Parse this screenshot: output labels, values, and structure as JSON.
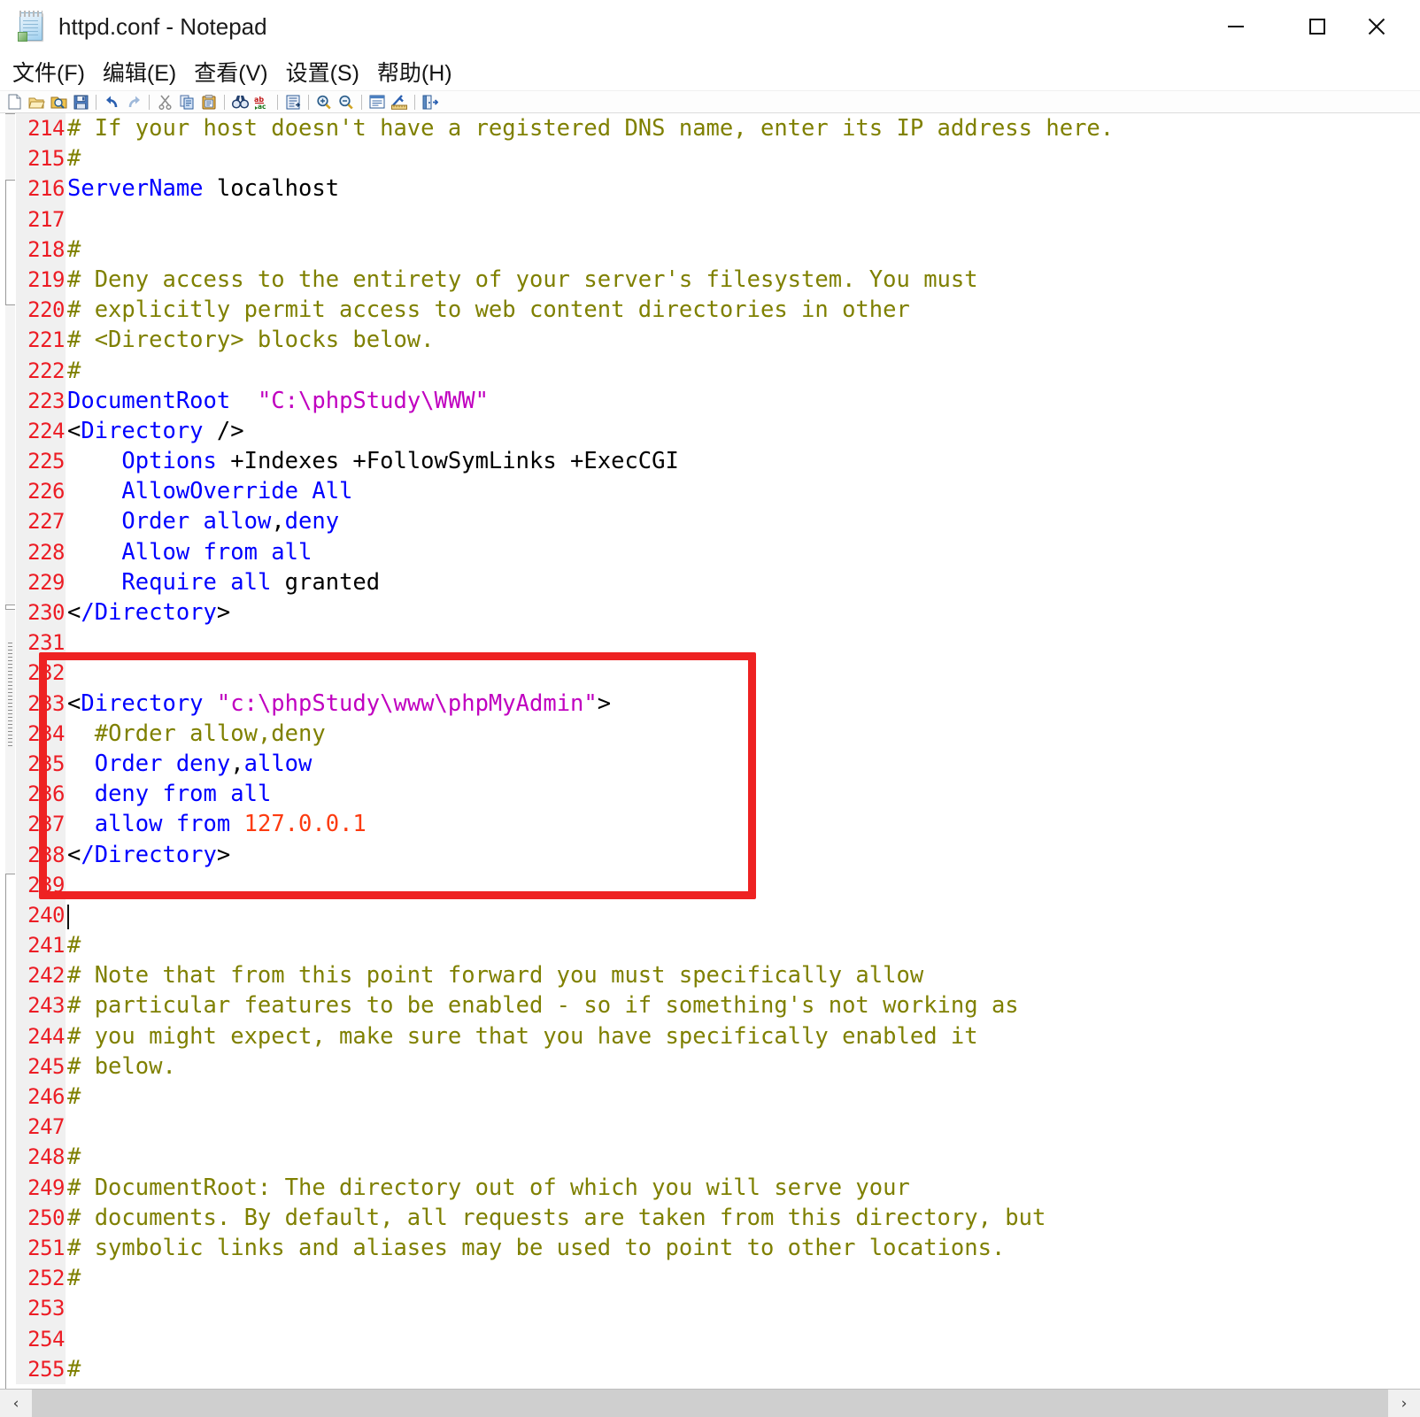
{
  "window": {
    "title": "httpd.conf - Notepad",
    "icon": "notepad-icon",
    "minimize_label": "–",
    "maximize_label": "□",
    "close_label": "✕"
  },
  "menubar": {
    "items": [
      {
        "label": "文件(F)",
        "name": "menu-file"
      },
      {
        "label": "编辑(E)",
        "name": "menu-edit"
      },
      {
        "label": "查看(V)",
        "name": "menu-view"
      },
      {
        "label": "设置(S)",
        "name": "menu-settings"
      },
      {
        "label": "帮助(H)",
        "name": "menu-help"
      }
    ]
  },
  "toolbar": {
    "buttons": [
      {
        "icon": "new-file-icon",
        "title": "New"
      },
      {
        "icon": "open-folder-icon",
        "title": "Open"
      },
      {
        "icon": "print-preview-icon",
        "title": "Print Preview"
      },
      {
        "icon": "save-floppy-icon",
        "title": "Save"
      },
      {
        "icon": "undo-arrow-icon",
        "title": "Undo"
      },
      {
        "icon": "redo-arrow-icon",
        "title": "Redo"
      },
      {
        "icon": "cut-scissors-icon",
        "title": "Cut"
      },
      {
        "icon": "copy-icon",
        "title": "Copy"
      },
      {
        "icon": "paste-clipboard-icon",
        "title": "Paste"
      },
      {
        "icon": "find-binoculars-icon",
        "title": "Find"
      },
      {
        "icon": "replace-abc-icon",
        "title": "Replace"
      },
      {
        "icon": "goto-line-icon",
        "title": "Go To"
      },
      {
        "icon": "zoom-in-icon",
        "title": "Zoom In"
      },
      {
        "icon": "zoom-out-icon",
        "title": "Zoom Out"
      },
      {
        "icon": "properties-icon",
        "title": "Properties"
      },
      {
        "icon": "edit-ruler-icon",
        "title": "Edit"
      },
      {
        "icon": "exit-door-icon",
        "title": "Exit"
      }
    ]
  },
  "editor": {
    "first_visible_line": 214,
    "last_visible_line": 254,
    "caret_line": 240,
    "colors": {
      "line_number": "#ec1c24",
      "gutter_background": "#f0f0f0",
      "comment": "#7f8000",
      "directive": "#0000ff",
      "string": "#c000c0",
      "number": "#fc3b10",
      "plain": "#000000",
      "annotation_box": "#ee2222"
    },
    "lines": [
      {
        "n": 214,
        "tokens": [
          {
            "t": "# If your host doesn't have a registered DNS name, enter its IP address here.",
            "c": "cm"
          }
        ]
      },
      {
        "n": 215,
        "tokens": [
          {
            "t": "#",
            "c": "cm"
          }
        ]
      },
      {
        "n": 216,
        "tokens": [
          {
            "t": "ServerName",
            "c": "kw"
          },
          {
            "t": " localhost",
            "c": "pl"
          }
        ]
      },
      {
        "n": 217,
        "tokens": [
          {
            "t": "",
            "c": "pl"
          }
        ]
      },
      {
        "n": 218,
        "tokens": [
          {
            "t": "#",
            "c": "cm"
          }
        ]
      },
      {
        "n": 219,
        "tokens": [
          {
            "t": "# Deny access to the entirety of your server's filesystem. You must",
            "c": "cm"
          }
        ]
      },
      {
        "n": 220,
        "tokens": [
          {
            "t": "# explicitly permit access to web content directories in other",
            "c": "cm"
          }
        ]
      },
      {
        "n": 221,
        "tokens": [
          {
            "t": "# <Directory> blocks below.",
            "c": "cm"
          }
        ]
      },
      {
        "n": 222,
        "tokens": [
          {
            "t": "#",
            "c": "cm"
          }
        ]
      },
      {
        "n": 223,
        "tokens": [
          {
            "t": "DocumentRoot",
            "c": "kw"
          },
          {
            "t": "  ",
            "c": "pl"
          },
          {
            "t": "\"C:\\phpStudy\\WWW\"",
            "c": "str"
          }
        ]
      },
      {
        "n": 224,
        "tokens": [
          {
            "t": "<",
            "c": "pl"
          },
          {
            "t": "Directory",
            "c": "kw"
          },
          {
            "t": " />",
            "c": "pl"
          }
        ]
      },
      {
        "n": 225,
        "tokens": [
          {
            "t": "    ",
            "c": "pl"
          },
          {
            "t": "Options",
            "c": "kw"
          },
          {
            "t": " +Indexes +FollowSymLinks +ExecCGI",
            "c": "pl"
          }
        ]
      },
      {
        "n": 226,
        "tokens": [
          {
            "t": "    ",
            "c": "pl"
          },
          {
            "t": "AllowOverride All",
            "c": "kw"
          }
        ]
      },
      {
        "n": 227,
        "tokens": [
          {
            "t": "    ",
            "c": "pl"
          },
          {
            "t": "Order allow",
            "c": "kw"
          },
          {
            "t": ",",
            "c": "pl"
          },
          {
            "t": "deny",
            "c": "kw"
          }
        ]
      },
      {
        "n": 228,
        "tokens": [
          {
            "t": "    ",
            "c": "pl"
          },
          {
            "t": "Allow from all",
            "c": "kw"
          }
        ]
      },
      {
        "n": 229,
        "tokens": [
          {
            "t": "    ",
            "c": "pl"
          },
          {
            "t": "Require all",
            "c": "kw"
          },
          {
            "t": " granted",
            "c": "pl"
          }
        ]
      },
      {
        "n": 230,
        "tokens": [
          {
            "t": "<",
            "c": "pl"
          },
          {
            "t": "/Directory",
            "c": "kw"
          },
          {
            "t": ">",
            "c": "pl"
          }
        ]
      },
      {
        "n": 231,
        "tokens": [
          {
            "t": "",
            "c": "pl"
          }
        ]
      },
      {
        "n": 232,
        "tokens": [
          {
            "t": "",
            "c": "pl"
          }
        ]
      },
      {
        "n": 233,
        "tokens": [
          {
            "t": "<",
            "c": "pl"
          },
          {
            "t": "Directory",
            "c": "kw"
          },
          {
            "t": " ",
            "c": "pl"
          },
          {
            "t": "\"c:\\phpStudy\\www\\phpMyAdmin\"",
            "c": "str"
          },
          {
            "t": ">",
            "c": "pl"
          }
        ]
      },
      {
        "n": 234,
        "tokens": [
          {
            "t": "  ",
            "c": "pl"
          },
          {
            "t": "#Order allow,deny",
            "c": "cm"
          }
        ]
      },
      {
        "n": 235,
        "tokens": [
          {
            "t": "  ",
            "c": "pl"
          },
          {
            "t": "Order deny",
            "c": "kw"
          },
          {
            "t": ",",
            "c": "pl"
          },
          {
            "t": "allow",
            "c": "kw"
          }
        ]
      },
      {
        "n": 236,
        "tokens": [
          {
            "t": "  ",
            "c": "pl"
          },
          {
            "t": "deny from all",
            "c": "kw"
          }
        ]
      },
      {
        "n": 237,
        "tokens": [
          {
            "t": "  ",
            "c": "pl"
          },
          {
            "t": "allow from ",
            "c": "kw"
          },
          {
            "t": "127.0.0.1",
            "c": "num"
          }
        ]
      },
      {
        "n": 238,
        "tokens": [
          {
            "t": "<",
            "c": "pl"
          },
          {
            "t": "/Directory",
            "c": "kw"
          },
          {
            "t": ">",
            "c": "pl"
          }
        ]
      },
      {
        "n": 239,
        "tokens": [
          {
            "t": "",
            "c": "pl"
          }
        ]
      },
      {
        "n": 240,
        "tokens": [
          {
            "t": "",
            "c": "pl"
          }
        ],
        "caret": true
      },
      {
        "n": 241,
        "tokens": [
          {
            "t": "#",
            "c": "cm"
          }
        ]
      },
      {
        "n": 242,
        "tokens": [
          {
            "t": "# Note that from this point forward you must specifically allow",
            "c": "cm"
          }
        ]
      },
      {
        "n": 243,
        "tokens": [
          {
            "t": "# particular features to be enabled - so if something's not working as",
            "c": "cm"
          }
        ]
      },
      {
        "n": 244,
        "tokens": [
          {
            "t": "# you might expect, make sure that you have specifically enabled it",
            "c": "cm"
          }
        ]
      },
      {
        "n": 245,
        "tokens": [
          {
            "t": "# below.",
            "c": "cm"
          }
        ]
      },
      {
        "n": 246,
        "tokens": [
          {
            "t": "#",
            "c": "cm"
          }
        ]
      },
      {
        "n": 247,
        "tokens": [
          {
            "t": "",
            "c": "pl"
          }
        ]
      },
      {
        "n": 248,
        "tokens": [
          {
            "t": "#",
            "c": "cm"
          }
        ]
      },
      {
        "n": 249,
        "tokens": [
          {
            "t": "# DocumentRoot: The directory out of which you will serve your",
            "c": "cm"
          }
        ]
      },
      {
        "n": 250,
        "tokens": [
          {
            "t": "# documents. By default, all requests are taken from this directory, but",
            "c": "cm"
          }
        ]
      },
      {
        "n": 251,
        "tokens": [
          {
            "t": "# symbolic links and aliases may be used to point to other locations.",
            "c": "cm"
          }
        ]
      },
      {
        "n": 252,
        "tokens": [
          {
            "t": "#",
            "c": "cm"
          }
        ]
      },
      {
        "n": 253,
        "tokens": [
          {
            "t": "",
            "c": "pl"
          }
        ]
      },
      {
        "n": 254,
        "tokens": [
          {
            "t": "",
            "c": "pl"
          }
        ]
      },
      {
        "n": 255,
        "tokens": [
          {
            "t": "#",
            "c": "cm"
          }
        ]
      }
    ],
    "annotation": {
      "shape": "rectangle",
      "color": "#ee2222",
      "covers_lines": "232-239"
    }
  },
  "hscrollbar": {
    "left_arrow": "‹",
    "right_arrow": "›"
  }
}
